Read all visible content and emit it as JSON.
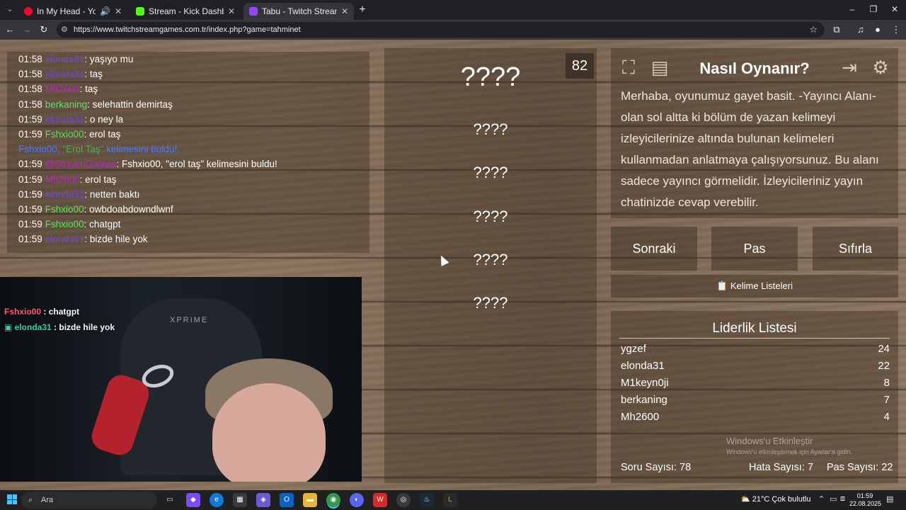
{
  "browser": {
    "tabs": [
      {
        "title": "In My Head - YouTube Mus",
        "favicon_color": "#ff0033"
      },
      {
        "title": "Stream - Kick Dashboard",
        "favicon_color": "#53fc18"
      },
      {
        "title": "Tabu - Twitch Stream Games",
        "favicon_color": "#9146ff"
      }
    ],
    "url": "https://www.twitchstreamgames.com.tr/index.php?game=tahminet"
  },
  "chat": {
    "lines": [
      {
        "time": "01:58",
        "user": "elonda31",
        "color": "#6a4bd6",
        "text": ": yaşıyo mu"
      },
      {
        "time": "01:58",
        "user": "elonda31",
        "color": "#6a4bd6",
        "text": ": taş"
      },
      {
        "time": "01:58",
        "user": "Mh2600",
        "color": "#c322c7",
        "text": ": taş"
      },
      {
        "time": "01:58",
        "user": "berkaning",
        "color": "#5fe05f",
        "text": ": selehattin demirtaş"
      },
      {
        "time": "01:59",
        "user": "elonda31",
        "color": "#6a4bd6",
        "text": ": o ney la"
      },
      {
        "time": "01:59",
        "user": "Fshxio00",
        "color": "#5fe05f",
        "text": ": erol taş"
      },
      {
        "time": "",
        "user": "",
        "color": "#4a7bff",
        "text": ""
      },
      {
        "time": "01:59",
        "user": "@StreamGames",
        "color": "#c322c7",
        "text": ": Fshxio00, \"erol taş\" kelimesini buldu!"
      },
      {
        "time": "01:59",
        "user": "Mh2600",
        "color": "#c322c7",
        "text": ": erol taş"
      },
      {
        "time": "01:59",
        "user": "elonda31",
        "color": "#6a4bd6",
        "text": ": netten baktı"
      },
      {
        "time": "01:59",
        "user": "Fshxio00",
        "color": "#5fe05f",
        "text": ": owbdoabdowndlwnf"
      },
      {
        "time": "01:59",
        "user": "Fshxio00",
        "color": "#5fe05f",
        "text": ": chatgpt"
      },
      {
        "time": "01:59",
        "user": "elonda31",
        "color": "#6a4bd6",
        "text": ": bizde hile yok"
      }
    ],
    "system_line": {
      "pre": "Fshxio00, \"",
      "word": "Erol Taş",
      "post": "\" kelimesini buldu!."
    }
  },
  "webcam": {
    "brand": "XPRIME",
    "overlay": [
      {
        "user": "Fshxio00",
        "color": "#ff5a7a",
        "text": " : chatgpt"
      },
      {
        "user": "elonda31",
        "color": "#35d3a6",
        "text": " : bizde hile yok"
      }
    ]
  },
  "game": {
    "timer": "82",
    "main_word": "????",
    "taboo_words": [
      "????",
      "????",
      "????",
      "????",
      "????"
    ]
  },
  "howto": {
    "title": "Nasıl Oynanır?",
    "body": "Merhaba, oyunumuz gayet basit. -Yayıncı Alanı- olan sol altta ki bölüm de yazan kelimeyi izleyicilerinize altında bulunan kelimeleri kullanmadan anlatmaya çalışıyorsunuz. Bu alanı sadece yayıncı görmelidir. İzleyicileriniz yayın chatinizde cevap verebilir.",
    "icons": [
      "fullscreen-icon",
      "notes-icon",
      "logout-icon",
      "gear-icon"
    ]
  },
  "controls": {
    "next": "Sonraki",
    "pass": "Pas",
    "reset": "Sıfırla",
    "word_lists": "📋 Kelime Listeleri"
  },
  "leaderboard": {
    "title": "Liderlik Listesi",
    "rows": [
      {
        "name": "ygzef",
        "score": "24"
      },
      {
        "name": "elonda31",
        "score": "22"
      },
      {
        "name": "M1keyn0ji",
        "score": "8"
      },
      {
        "name": "berkaning",
        "score": "7"
      },
      {
        "name": "Mh2600",
        "score": "4"
      }
    ],
    "questions": "Soru Sayısı: 78",
    "errors": "Hata Sayısı: 7",
    "passes": "Pas Sayısı: 22"
  },
  "watermark": {
    "line1": "Windows'u Etkinleştir",
    "line2": "Windows'u etkinleştirmek için Ayarlar'a gidin."
  },
  "taskbar": {
    "search": "Ara",
    "weather": "21°C  Çok bulutlu",
    "time": "01:59",
    "date": "22.08.2025"
  }
}
